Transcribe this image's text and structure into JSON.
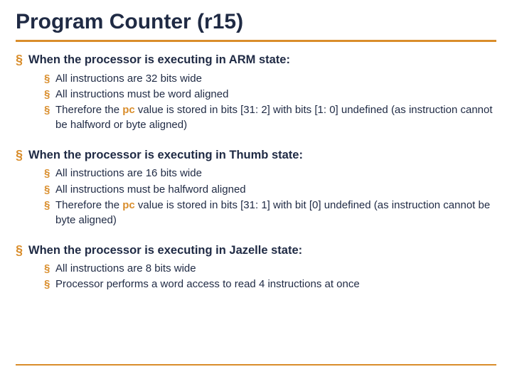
{
  "title": "Program Counter (r15)",
  "hl_keyword": "pc",
  "sections": [
    {
      "heading": "When the processor is executing in ARM state:",
      "items": [
        {
          "pre": "All instructions are 32 bits wide"
        },
        {
          "pre": "All instructions must be word aligned"
        },
        {
          "pre": "Therefore the ",
          "kw": "pc",
          "post": " value is stored in bits [31: 2] with bits [1: 0] undefined (as instruction cannot be halfword or byte aligned)"
        }
      ]
    },
    {
      "heading": "When the processor is executing in Thumb state:",
      "items": [
        {
          "pre": "All instructions are 16 bits wide"
        },
        {
          "pre": "All instructions must be halfword aligned"
        },
        {
          "pre": "Therefore the ",
          "kw": "pc",
          "post": " value is stored in bits [31: 1] with bit [0] undefined (as instruction cannot be byte aligned)"
        }
      ]
    },
    {
      "heading": "When the processor is executing in Jazelle state:",
      "items": [
        {
          "pre": "All instructions are 8 bits wide"
        },
        {
          "pre": "Processor performs a word access to read 4 instructions at once"
        }
      ]
    }
  ]
}
